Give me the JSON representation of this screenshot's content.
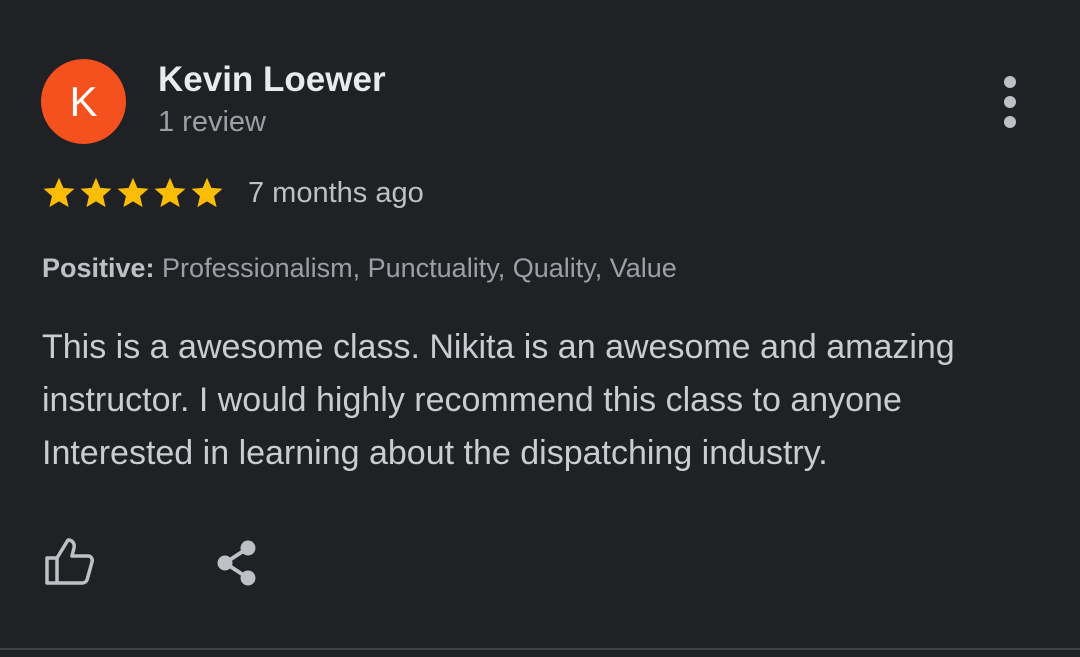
{
  "reviewer": {
    "avatar_letter": "K",
    "avatar_color": "#f4511e",
    "name": "Kevin Loewer",
    "review_count": "1 review"
  },
  "rating": {
    "stars": 5,
    "max_stars": 5,
    "star_color": "#fbbc04",
    "time": "7 months ago"
  },
  "attributes": {
    "label": "Positive:",
    "values": " Professionalism, Punctuality, Quality, Value"
  },
  "review_text": "This is a awesome class. Nikita is an awesome and amazing instructor. I would highly recommend this class to anyone Interested in learning about the dispatching industry.",
  "actions": {
    "like_icon": "thumbs-up-icon",
    "share_icon": "share-icon",
    "more_icon": "more-vertical-icon"
  }
}
